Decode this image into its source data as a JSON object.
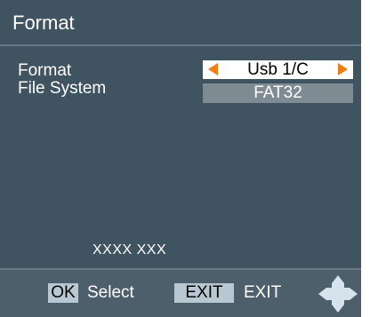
{
  "title": "Format",
  "rows": [
    {
      "label": "Format",
      "value": "Usb 1/C"
    },
    {
      "label": "File System",
      "value": "FAT32"
    }
  ],
  "info": "XXXX XXX",
  "footer": {
    "ok_key": "OK",
    "ok_label": "Select",
    "exit_key": "EXIT",
    "exit_label": "EXIT"
  },
  "colors": {
    "background": "#3f5360",
    "footer": "#4d5f6b",
    "arrow": "#f07c14",
    "key_badge": "#b8c8d3",
    "dpad": "#d6e3ec"
  },
  "icons": {
    "left_arrow": "left-arrow-icon",
    "right_arrow": "right-arrow-icon",
    "navigation": "dpad-icon"
  }
}
